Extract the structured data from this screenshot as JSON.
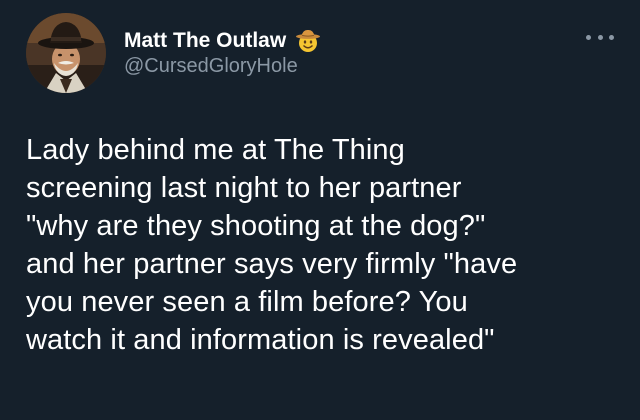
{
  "author": {
    "display_name": "Matt The Outlaw",
    "handle": "@CursedGloryHole",
    "name_emoji": "cowboy-hat-face-emoji",
    "avatar": "avatar-icon"
  },
  "menu": {
    "icon": "more-options-icon"
  },
  "tweet": {
    "lines": [
      "Lady behind me at The Thing",
      "screening last night to her partner",
      "\"why are they shooting at the dog?\"",
      "and her partner says very firmly \"have",
      "you never seen a film before? You",
      "watch it and information is revealed\""
    ]
  },
  "colors": {
    "background": "#15202b",
    "text": "#ffffff",
    "secondary_text": "#8b98a5"
  }
}
